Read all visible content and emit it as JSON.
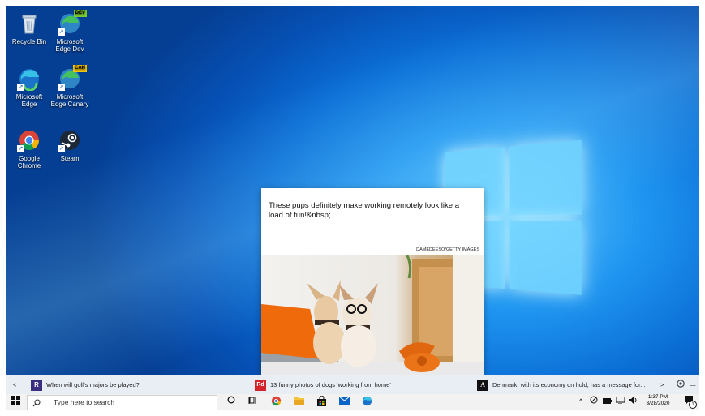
{
  "desktop": {
    "icons": [
      {
        "label": "Recycle Bin"
      },
      {
        "label": "Microsoft Edge Dev",
        "badge": "DEV"
      },
      {
        "label": "Microsoft Edge"
      },
      {
        "label": "Microsoft Edge Canary",
        "badge": "CAN"
      },
      {
        "label": "Google Chrome"
      },
      {
        "label": "Steam"
      }
    ]
  },
  "popup": {
    "headline": "These pups definitely make working remotely look like a load of fun!&nbsp;",
    "credit": "DAMEDEESO/GETTY IMAGES"
  },
  "news_bar": {
    "prev": "<",
    "next": ">",
    "items": [
      {
        "logo": "R",
        "text": "When will golf's majors be played?",
        "color": "#3b2e7e"
      },
      {
        "logo": "Rd",
        "text": "13 funny photos of dogs 'working from home'",
        "color": "#d2242a"
      },
      {
        "logo": "A",
        "text": "Denmark, with its economy on hold, has a message for...",
        "color": "#111111"
      }
    ],
    "more": "—"
  },
  "taskbar": {
    "search_placeholder": "Type here to search",
    "time": "1:37 PM",
    "date": "3/28/2020",
    "notification_count": "1"
  },
  "colors": {
    "accent": "#0078d7",
    "taskbar": "#f2f2f2"
  }
}
